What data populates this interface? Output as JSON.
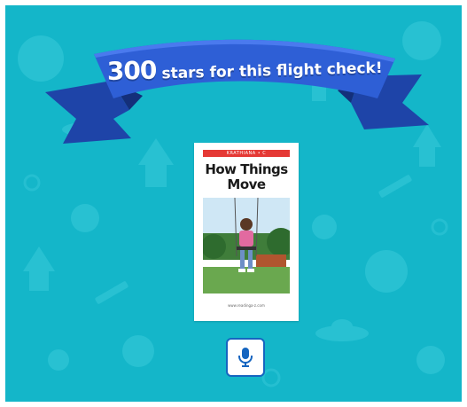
{
  "banner": {
    "number": "300",
    "label": "stars for this flight check!"
  },
  "book": {
    "level_label": "KRATHIANA • C",
    "title": "How Things Move",
    "footer": "www.readinga-z.com"
  },
  "mic": {
    "icon": "microphone-icon"
  },
  "colors": {
    "background": "#14b6c9",
    "banner": "#2e5fd6",
    "mic_accent": "#1565c0"
  }
}
